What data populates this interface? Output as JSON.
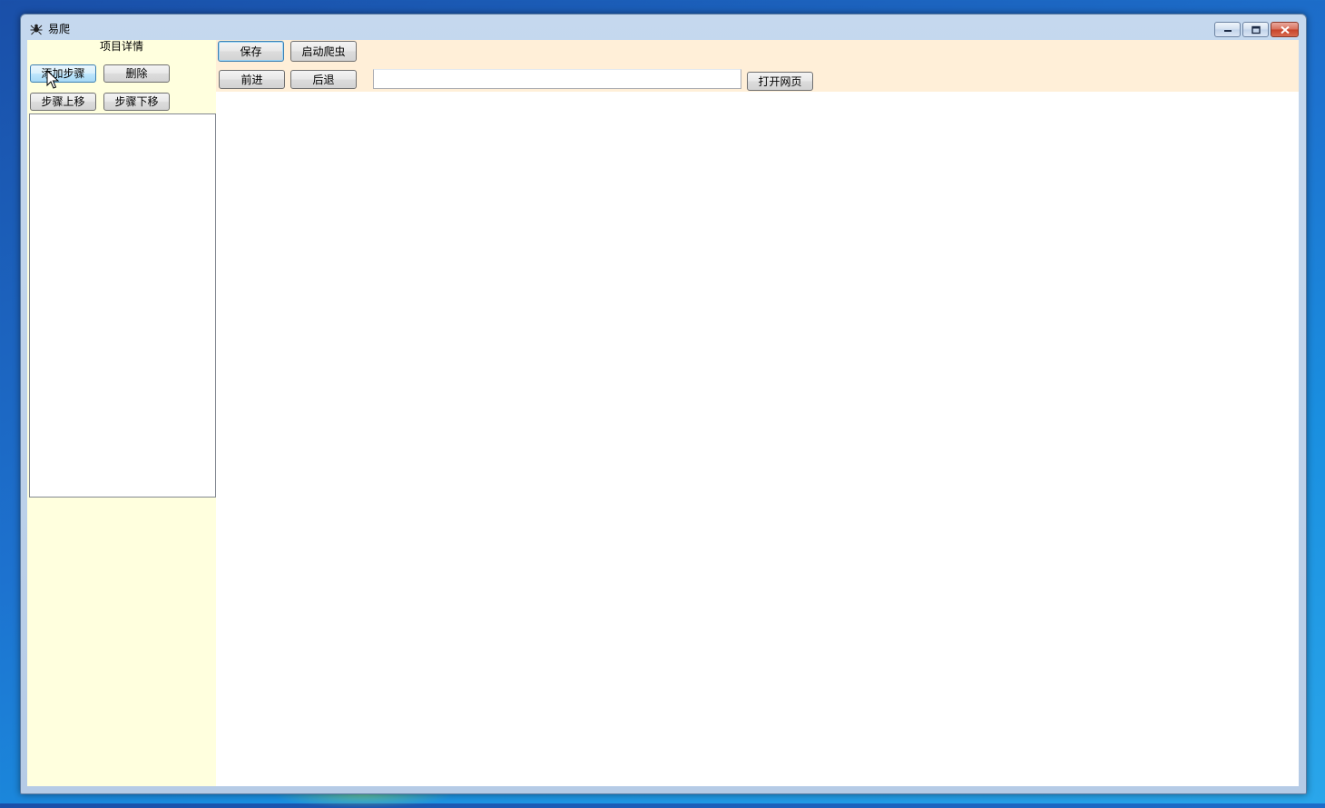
{
  "window": {
    "title": "易爬",
    "icon": "spider-app-icon",
    "controls": [
      "minimize-icon",
      "maximize-icon",
      "close-icon"
    ]
  },
  "left_panel": {
    "title": "项目详情",
    "buttons": {
      "add_step": "添加步骤",
      "delete": "删除",
      "move_up": "步骤上移",
      "move_down": "步骤下移"
    },
    "steps": []
  },
  "toolbar": {
    "save": "保存",
    "start_crawler": "启动爬虫",
    "forward": "前进",
    "back": "后退",
    "url_value": "",
    "open_page": "打开网页"
  },
  "colors": {
    "left_panel_bg": "#ffffde",
    "toolbar_bg": "#ffefd8",
    "content_bg": "#ffffff"
  }
}
